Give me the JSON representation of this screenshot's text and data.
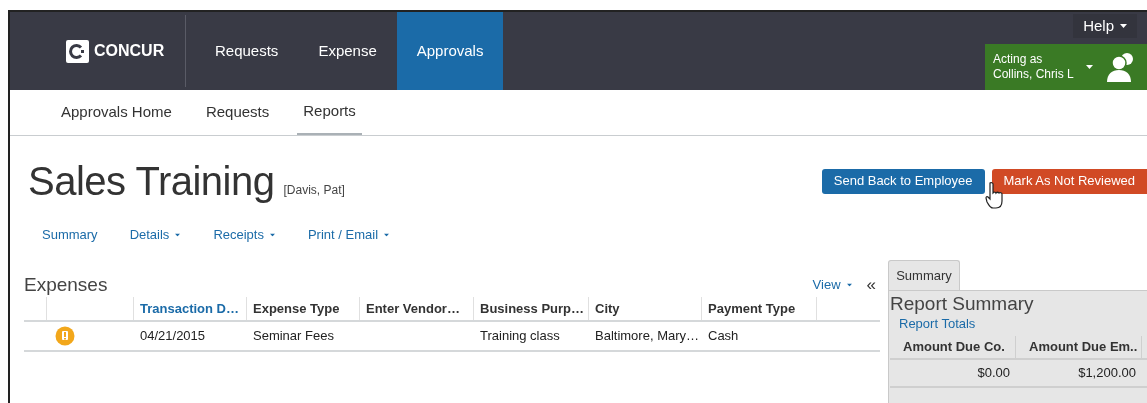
{
  "header": {
    "logo": "CONCUR",
    "nav": [
      {
        "label": "Requests",
        "selected": false
      },
      {
        "label": "Expense",
        "selected": false
      },
      {
        "label": "Approvals",
        "selected": true
      }
    ],
    "help": "Help",
    "acting_as": {
      "line_1": "Acting as",
      "line_2": "Collins, Chris L"
    }
  },
  "sub_nav": [
    {
      "label": "Approvals Home",
      "selected": false
    },
    {
      "label": "Requests",
      "selected": false
    },
    {
      "label": "Reports",
      "selected": true
    }
  ],
  "report": {
    "title": "Sales Training",
    "employee": "[Davis, Pat]"
  },
  "buttons": [
    {
      "label": "Send Back to Employee",
      "kind": "primary"
    },
    {
      "label": "Mark As Not Reviewed",
      "kind": "danger"
    }
  ],
  "report_menu": [
    {
      "label": "Summary",
      "dropdown": false
    },
    {
      "label": "Details",
      "dropdown": true
    },
    {
      "label": "Receipts",
      "dropdown": true
    },
    {
      "label": "Print / Email",
      "dropdown": true
    }
  ],
  "expenses": {
    "title": "Expenses",
    "view": "View",
    "collapse": "«",
    "columns": [
      {
        "label": "Transaction D…",
        "sorted": true
      },
      {
        "label": "Expense Type",
        "sorted": false
      },
      {
        "label": "Enter Vendor…",
        "sorted": false
      },
      {
        "label": "Business Purp…",
        "sorted": false
      },
      {
        "label": "City",
        "sorted": false
      },
      {
        "label": "Payment Type",
        "sorted": false
      }
    ],
    "rows": [
      {
        "alert": true,
        "cells": [
          "04/21/2015",
          "Seminar Fees",
          "",
          "Training class",
          "Baltimore, Mary…",
          "Cash"
        ]
      }
    ]
  },
  "summary_panel": {
    "tab": "Summary",
    "title": "Report Summary",
    "link": "Report Totals",
    "columns": [
      "Amount Due Co.",
      "Amount Due Em.."
    ],
    "values": [
      "$0.00",
      "$1,200.00"
    ]
  }
}
